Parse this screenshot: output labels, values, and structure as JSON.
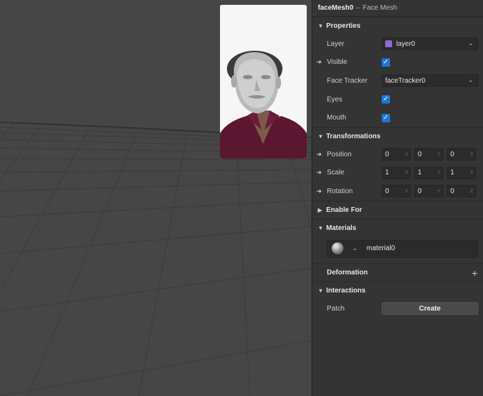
{
  "inspector": {
    "object_name": "faceMesh0",
    "separator": "–",
    "object_type": "Face Mesh"
  },
  "properties": {
    "header": "Properties",
    "layer": {
      "label": "Layer",
      "value": "layer0",
      "color": "#8d6bd4"
    },
    "visible": {
      "label": "Visible",
      "checked": true
    },
    "face_tracker": {
      "label": "Face Tracker",
      "value": "faceTracker0"
    },
    "eyes": {
      "label": "Eyes",
      "checked": true
    },
    "mouth": {
      "label": "Mouth",
      "checked": true
    }
  },
  "transformations": {
    "header": "Transformations",
    "position": {
      "label": "Position",
      "x": "0",
      "y": "0",
      "z": "0"
    },
    "scale": {
      "label": "Scale",
      "x": "1",
      "y": "1",
      "z": "1"
    },
    "rotation": {
      "label": "Rotation",
      "x": "0",
      "y": "0",
      "z": "0"
    },
    "axes": {
      "x": "X",
      "y": "Y",
      "z": "Z"
    }
  },
  "enable_for": {
    "header": "Enable For"
  },
  "materials": {
    "header": "Materials",
    "material_name": "material0"
  },
  "deformation": {
    "header": "Deformation",
    "add_symbol": "+"
  },
  "interactions": {
    "header": "Interactions",
    "patch_label": "Patch",
    "create_label": "Create"
  },
  "icons": {
    "expand": "triangle-down-icon",
    "bind": "arrow-right-circle-icon",
    "dropdown": "chevron-down-icon",
    "check": "checkmark-icon"
  },
  "colors": {
    "accent": "#1d79d6",
    "panel_bg": "#343434",
    "viewport_bg": "#464646"
  }
}
